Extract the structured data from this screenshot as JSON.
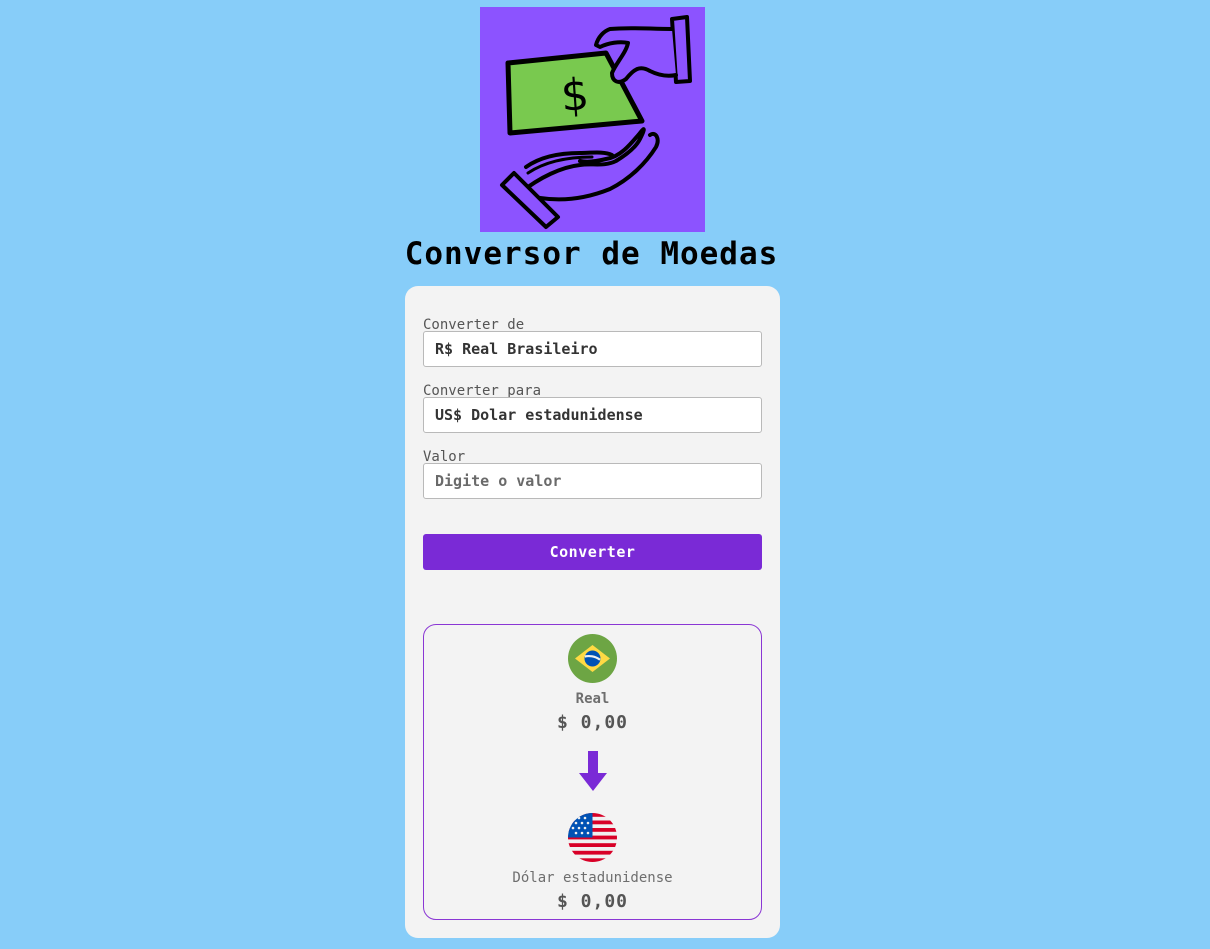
{
  "header": {
    "title": "Conversor de Moedas"
  },
  "form": {
    "from_label": "Converter de",
    "from_value": "R$ Real Brasileiro",
    "to_label": "Converter para",
    "to_value": "US$ Dolar estadunidense",
    "amount_label": "Valor",
    "amount_placeholder": "Digite o valor",
    "amount_value": "",
    "convert_button": "Converter"
  },
  "result": {
    "source": {
      "name": "Real",
      "value": "$ 0,00",
      "flag_icon": "brazil-flag-icon"
    },
    "arrow_icon": "arrow-down-icon",
    "target": {
      "name": "Dólar estadunidense",
      "value": "$ 0,00",
      "flag_icon": "usa-flag-icon"
    }
  },
  "colors": {
    "background": "#87cdf9",
    "card": "#f3f3f3",
    "accent": "#7a2ad6",
    "logo_background": "#8c53ff",
    "banknote": "#79c94f"
  },
  "logo_icon": "money-exchange-hands-icon"
}
